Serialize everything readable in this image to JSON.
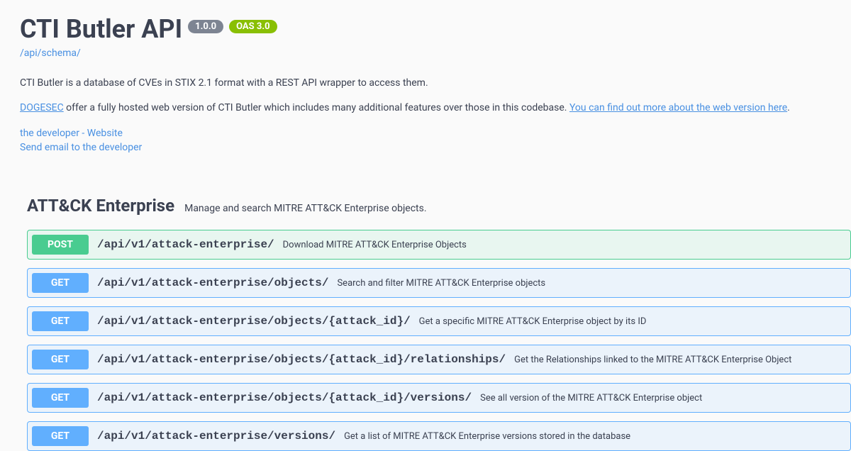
{
  "title": "CTI Butler API",
  "version": "1.0.0",
  "oas": "OAS 3.0",
  "schema_link": "/api/schema/",
  "description_intro": "CTI Butler is a database of CVEs in STIX 2.1 format with a REST API wrapper to access them.",
  "desc_link1_text": "DOGESEC",
  "desc_middle": " offer a fully hosted web version of CTI Butler which includes many additional features over those in this codebase. ",
  "desc_link2_text": "You can find out more about the web version here",
  "desc_end": ".",
  "contact_dev": "the developer - Website",
  "contact_email": "Send email to the developer",
  "section": {
    "name": "ATT&CK Enterprise",
    "desc": "Manage and search MITRE ATT&CK Enterprise objects."
  },
  "endpoints": [
    {
      "method": "POST",
      "path": "/api/v1/attack-enterprise/",
      "summary": "Download MITRE ATT&CK Enterprise Objects"
    },
    {
      "method": "GET",
      "path": "/api/v1/attack-enterprise/objects/",
      "summary": "Search and filter MITRE ATT&CK Enterprise objects"
    },
    {
      "method": "GET",
      "path": "/api/v1/attack-enterprise/objects/{attack_id}/",
      "summary": "Get a specific MITRE ATT&CK Enterprise object by its ID"
    },
    {
      "method": "GET",
      "path": "/api/v1/attack-enterprise/objects/{attack_id}/relationships/",
      "summary": "Get the Relationships linked to the MITRE ATT&CK Enterprise Object"
    },
    {
      "method": "GET",
      "path": "/api/v1/attack-enterprise/objects/{attack_id}/versions/",
      "summary": "See all version of the MITRE ATT&CK Enterprise object"
    },
    {
      "method": "GET",
      "path": "/api/v1/attack-enterprise/versions/",
      "summary": "Get a list of MITRE ATT&CK Enterprise versions stored in the database"
    }
  ]
}
